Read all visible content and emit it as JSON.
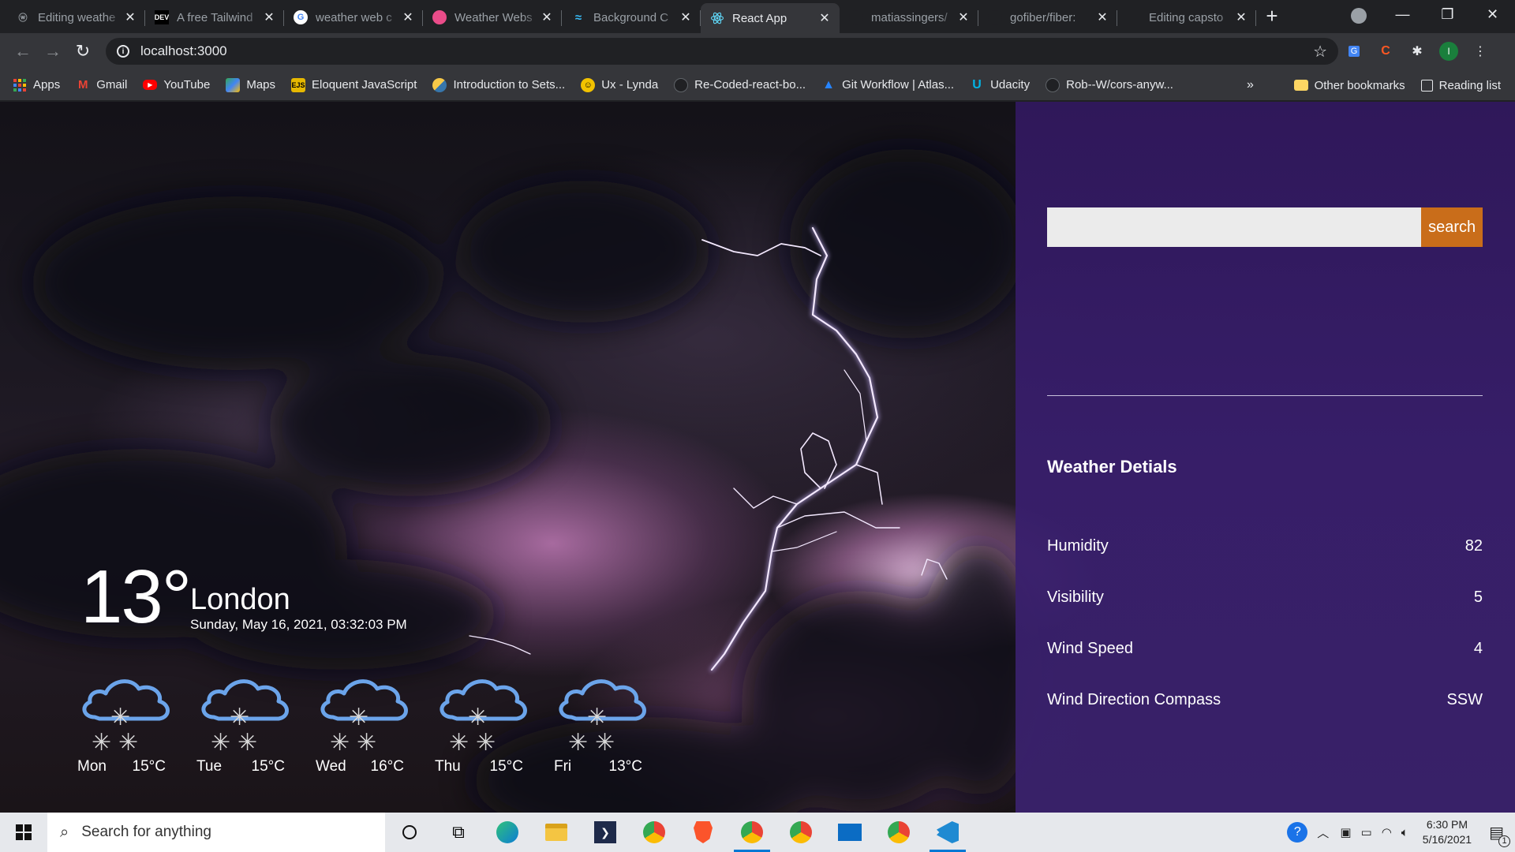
{
  "browser": {
    "tabs": [
      {
        "title": "Editing weathe",
        "favicon": "wordpress-icon",
        "active": false
      },
      {
        "title": "A free Tailwind",
        "favicon": "dev-icon",
        "active": false
      },
      {
        "title": "weather web c",
        "favicon": "google-icon",
        "active": false
      },
      {
        "title": "Weather Webs",
        "favicon": "dribbble-icon",
        "active": false
      },
      {
        "title": "Background C",
        "favicon": "tailwind-icon",
        "active": false
      },
      {
        "title": "React App",
        "favicon": "react-icon",
        "active": true
      },
      {
        "title": "matiassingers/",
        "favicon": "github-icon",
        "active": false
      },
      {
        "title": "gofiber/fiber:",
        "favicon": "github-icon",
        "active": false
      },
      {
        "title": "Editing capsto",
        "favicon": "wordpress-icon",
        "active": false
      }
    ],
    "url": "localhost:3000",
    "bookmarks": [
      {
        "label": "Apps",
        "icon": "apps-grid-icon",
        "color": "#ea4335"
      },
      {
        "label": "Gmail",
        "icon": "gmail-icon",
        "color": "#ea4335"
      },
      {
        "label": "YouTube",
        "icon": "youtube-icon",
        "color": "#ff0000"
      },
      {
        "label": "Maps",
        "icon": "maps-icon",
        "color": "#34a853"
      },
      {
        "label": "Eloquent JavaScript",
        "icon": "book-icon",
        "color": "#e6b800"
      },
      {
        "label": "Introduction to Sets...",
        "icon": "python-icon",
        "color": "#f7c948"
      },
      {
        "label": "Ux - Lynda",
        "icon": "lynda-icon",
        "color": "#f2c200"
      },
      {
        "label": "Re-Coded-react-bo...",
        "icon": "github-icon",
        "color": "#24292e"
      },
      {
        "label": "Git Workflow | Atlas...",
        "icon": "atlassian-icon",
        "color": "#2684ff"
      },
      {
        "label": "Udacity",
        "icon": "udacity-icon",
        "color": "#02b3e4"
      },
      {
        "label": "Rob--W/cors-anyw...",
        "icon": "github-icon",
        "color": "#24292e"
      }
    ],
    "bookmarks_more": "»",
    "other_bookmarks": "Other bookmarks",
    "reading_list": "Reading list"
  },
  "app": {
    "search_button": "search",
    "search_placeholder": "",
    "details_title": "Weather Detials",
    "details": [
      {
        "label": "Humidity",
        "value": "82"
      },
      {
        "label": "Visibility",
        "value": "5"
      },
      {
        "label": "Wind Speed",
        "value": "4"
      },
      {
        "label": "Wind Direction Compass",
        "value": "SSW"
      }
    ],
    "current": {
      "temp": "13°",
      "city": "London",
      "datetime": "Sunday, May 16, 2021, 03:32:03 PM"
    },
    "forecast": [
      {
        "day": "Mon",
        "temp": "15°C",
        "icon": "snow-cloud-icon"
      },
      {
        "day": "Tue",
        "temp": "15°C",
        "icon": "snow-cloud-icon"
      },
      {
        "day": "Wed",
        "temp": "16°C",
        "icon": "snow-cloud-icon"
      },
      {
        "day": "Thu",
        "temp": "15°C",
        "icon": "snow-cloud-icon"
      },
      {
        "day": "Fri",
        "temp": "13°C",
        "icon": "snow-cloud-icon"
      }
    ],
    "colors": {
      "panel": "#30185c",
      "button": "#c96d1a",
      "cloud_stroke": "#6ba4ea"
    }
  },
  "taskbar": {
    "search_placeholder": "Search for anything",
    "apps": [
      "cortana-icon",
      "task-view-icon",
      "edge-icon",
      "file-explorer-icon",
      "powershell-icon",
      "chrome-icon",
      "brave-icon",
      "chrome-icon",
      "chrome-icon",
      "mail-icon",
      "chrome-icon",
      "vscode-icon"
    ],
    "time": "6:30 PM",
    "date": "5/16/2021",
    "notifications": "1"
  }
}
